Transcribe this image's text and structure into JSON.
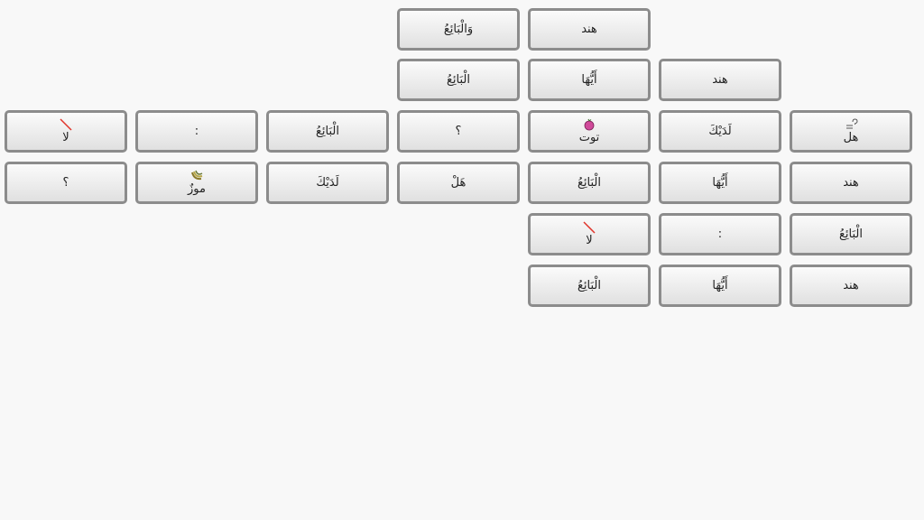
{
  "tiles": {
    "row1": {
      "col4": "وَالْبَائِعُ",
      "col5": "هند"
    },
    "row2": {
      "col4": "الْبَائِعُ",
      "col5": "أَيُّهَا",
      "col6": "هند"
    },
    "row3": {
      "col1": "لا",
      "col2": ":",
      "col3": "الْبَائِعُ",
      "col4": "؟",
      "col5": "توت",
      "col6": "لَدَيْكَ",
      "col7": "هل"
    },
    "row4": {
      "col1": "؟",
      "col2": "موزٌ",
      "col3": "لَدَيْكَ",
      "col4": "هَلْ",
      "col5": "الْبَائِعُ",
      "col6": "أَيُّهَا",
      "col7": "هند"
    },
    "row5": {
      "col5": "لا",
      "col6": ":",
      "col7": "الْبَائِعُ"
    },
    "row6": {
      "col5": "الْبَائِعُ",
      "col6": "أَيُّهَا",
      "col7": "هند"
    }
  },
  "icons": {
    "no": "red-slash-icon",
    "question": "question-mark-icon",
    "berry": "berry-icon",
    "banana": "banana-icon"
  },
  "colors": {
    "tile_border": "#8c8c8c",
    "background": "#f8f8f8",
    "slash": "#e0342a",
    "berry": "#c0398a"
  }
}
